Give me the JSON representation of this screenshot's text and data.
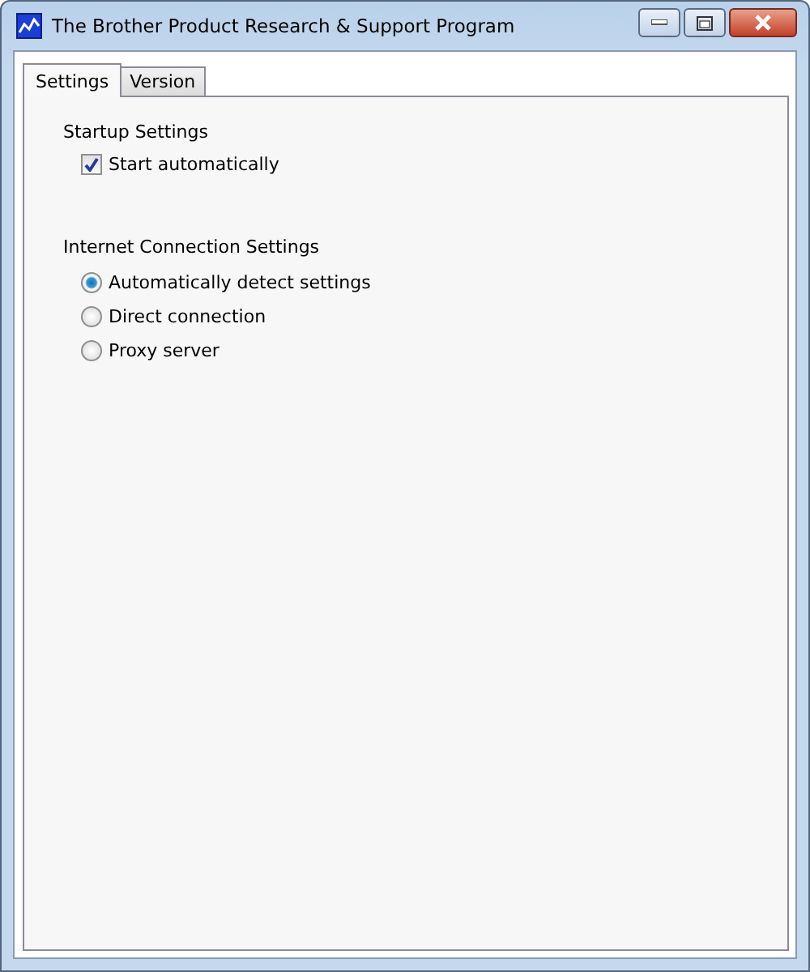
{
  "window": {
    "title": "The Brother Product Research & Support Program"
  },
  "tabs": [
    {
      "label": "Settings",
      "selected": true
    },
    {
      "label": "Version",
      "selected": false
    }
  ],
  "startup": {
    "heading": "Startup Settings",
    "checkbox": {
      "label": "Start automatically",
      "checked": true
    }
  },
  "internet": {
    "heading": "Internet Connection Settings",
    "options": [
      {
        "label": "Automatically detect settings",
        "selected": true
      },
      {
        "label": "Direct connection",
        "selected": false
      },
      {
        "label": "Proxy server",
        "selected": false
      }
    ]
  }
}
